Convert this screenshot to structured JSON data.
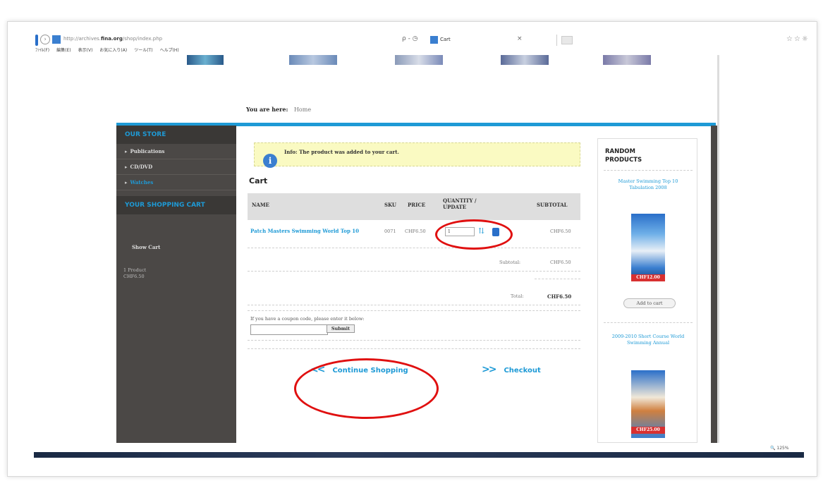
{
  "browser": {
    "url_prefix": "http://archives.",
    "url_domain": "fina.org",
    "url_path": "/shop/index.php",
    "search_controls": "ρ - ◷",
    "tab_title": "Cart",
    "tab_close": "×",
    "toolbar_icons": "☆☆☼",
    "menu": [
      "ﾌｧｲﾙ(F)",
      "編集(E)",
      "表示(V)",
      "お気に入り(A)",
      "ツール(T)",
      "ヘルプ(H)"
    ],
    "zoom": "🔍 125%"
  },
  "breadcrumb": {
    "label": "You are here:",
    "home": "Home"
  },
  "left": {
    "store_heading": "OUR STORE",
    "items": [
      {
        "label": "Publications",
        "active": false
      },
      {
        "label": "CD/DVD",
        "active": false
      },
      {
        "label": "Watches",
        "active": true
      }
    ],
    "cart_heading": "YOUR SHOPPING CART",
    "show_cart": "Show Cart",
    "summary_count": "1 Product",
    "summary_total": "CHF6.50"
  },
  "info": {
    "icon": "i",
    "text": "Info: The product was added to your cart."
  },
  "cart": {
    "title": "Cart",
    "columns": {
      "name": "NAME",
      "sku": "SKU",
      "price": "PRICE",
      "quantity_line1": "QUANTITY /",
      "quantity_line2": "UPDATE",
      "subtotal": "SUBTOTAL"
    },
    "row": {
      "name": "Patch Masters Swimming World Top 10",
      "sku": "0071",
      "price": "CHF6.50",
      "quantity": "1",
      "subtotal": "CHF6.50"
    },
    "subtotal_label": "Subtotal:",
    "subtotal_value": "CHF6.50",
    "total_label": "Total:",
    "total_value": "CHF6.50"
  },
  "coupon": {
    "text": "If you have a coupon code, please enter it below:",
    "button": "Submit"
  },
  "actions": {
    "continue_chevrons": "<<",
    "continue": "Continue Shopping",
    "checkout_chevrons": ">>",
    "checkout": "Checkout"
  },
  "random": {
    "heading_line1": "RANDOM",
    "heading_line2": "PRODUCTS",
    "product1": "Master Swimming Top 10 Tabulation 2008",
    "product1_price": "CHF12.00",
    "add_to_cart": "Add to cart",
    "product2": "2009-2010 Short Course World Swimming Annual",
    "product2_price": "CHF25.00"
  },
  "colors": {
    "accent": "#1e9ad6",
    "sidebar": "#4b4846",
    "annotation": "#e01010",
    "info_bg": "#fafac2"
  }
}
